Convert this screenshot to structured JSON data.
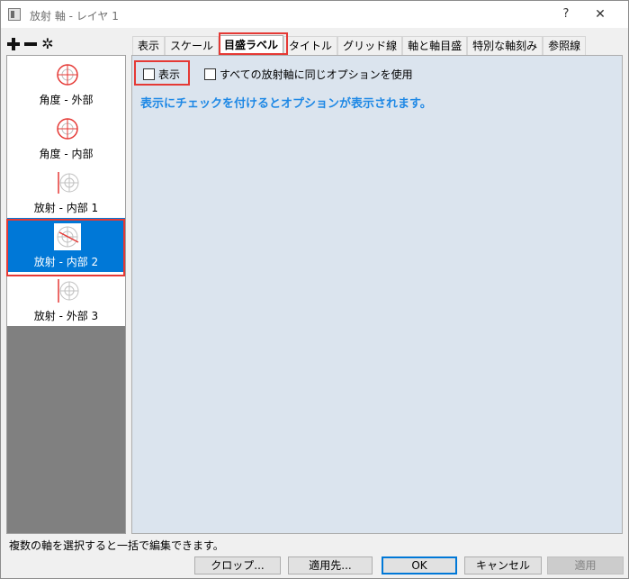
{
  "window": {
    "title": "放射 軸 - レイヤ 1",
    "help_label": "?",
    "close_label": "✕"
  },
  "toolbar": {
    "icons": [
      "plus-icon",
      "minus-icon",
      "gear-icon"
    ],
    "gear_glyph": "✲"
  },
  "axis_list": {
    "items": [
      {
        "label": "角度 - 外部",
        "icon": "angular-outer-icon"
      },
      {
        "label": "角度 - 内部",
        "icon": "angular-inner-icon"
      },
      {
        "label": "放射 - 内部 1",
        "icon": "radial-inner-1-icon"
      },
      {
        "label": "放射 - 内部 2",
        "icon": "radial-inner-2-icon",
        "selected": true
      },
      {
        "label": "放射 - 外部 3",
        "icon": "radial-outer-3-icon"
      }
    ]
  },
  "tabs": [
    {
      "label": "表示"
    },
    {
      "label": "スケール"
    },
    {
      "label": "目盛ラベル",
      "active": true
    },
    {
      "label": "タイトル"
    },
    {
      "label": "グリッド線"
    },
    {
      "label": "軸と軸目盛"
    },
    {
      "label": "特別な軸刻み"
    },
    {
      "label": "参照線"
    }
  ],
  "content": {
    "show_checkbox_label": "表示",
    "same_options_label": "すべての放射軸に同じオプションを使用",
    "hint": "表示にチェックを付けるとオプションが表示されます。"
  },
  "status_text": "複数の軸を選択すると一括で編集できます。",
  "buttons": {
    "crop": "クロップ...",
    "apply_to": "適用先...",
    "ok": "OK",
    "cancel": "キャンセル",
    "apply": "適用"
  },
  "colors": {
    "accent": "#0078d7",
    "highlight_frame": "#e53935",
    "hint_text": "#1e88e5",
    "content_bg": "#dbe4ee",
    "icon_red": "#e53935"
  }
}
